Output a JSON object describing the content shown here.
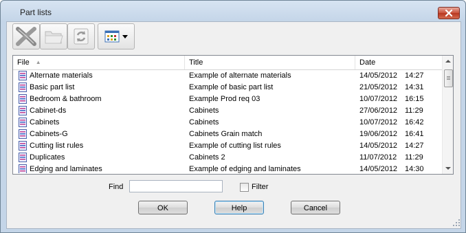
{
  "window": {
    "title": "Part lists",
    "close_icon": "close-icon"
  },
  "toolbar": {
    "buttons": [
      {
        "name": "delete",
        "icon": "delete-x-icon"
      },
      {
        "name": "open-folder",
        "icon": "folder-icon"
      },
      {
        "name": "refresh",
        "icon": "refresh-icon"
      },
      {
        "name": "view-options",
        "icon": "grid-view-icon"
      }
    ]
  },
  "list": {
    "columns": [
      "File",
      "Title",
      "Date"
    ],
    "sort_column": "File",
    "rows": [
      {
        "file": "Alternate materials",
        "title": "Example of alternate materials",
        "date": "14/05/2012",
        "time": "14:27"
      },
      {
        "file": "Basic part list",
        "title": "Example of basic part list",
        "date": "21/05/2012",
        "time": "14:31"
      },
      {
        "file": "Bedroom & bathroom",
        "title": "Example Prod req 03",
        "date": "10/07/2012",
        "time": "16:15"
      },
      {
        "file": "Cabinet-ds",
        "title": "Cabinets",
        "date": "27/06/2012",
        "time": "11:29"
      },
      {
        "file": "Cabinets",
        "title": "Cabinets",
        "date": "10/07/2012",
        "time": "16:42"
      },
      {
        "file": "Cabinets-G",
        "title": "Cabinets Grain match",
        "date": "19/06/2012",
        "time": "16:41"
      },
      {
        "file": "Cutting list rules",
        "title": "Example of cutting list rules",
        "date": "14/05/2012",
        "time": "14:27"
      },
      {
        "file": "Duplicates",
        "title": "Cabinets 2",
        "date": "11/07/2012",
        "time": "11:29"
      },
      {
        "file": "Edging and laminates",
        "title": "Example of edging and laminates",
        "date": "14/05/2012",
        "time": "14:30"
      }
    ]
  },
  "find": {
    "label": "Find",
    "value": ""
  },
  "filter": {
    "label": "Filter",
    "checked": false
  },
  "buttons": {
    "ok": "OK",
    "help": "Help",
    "cancel": "Cancel"
  },
  "colors": {
    "frame": "#c4d5e8",
    "close": "#c9503a",
    "client": "#f0f0f0"
  }
}
